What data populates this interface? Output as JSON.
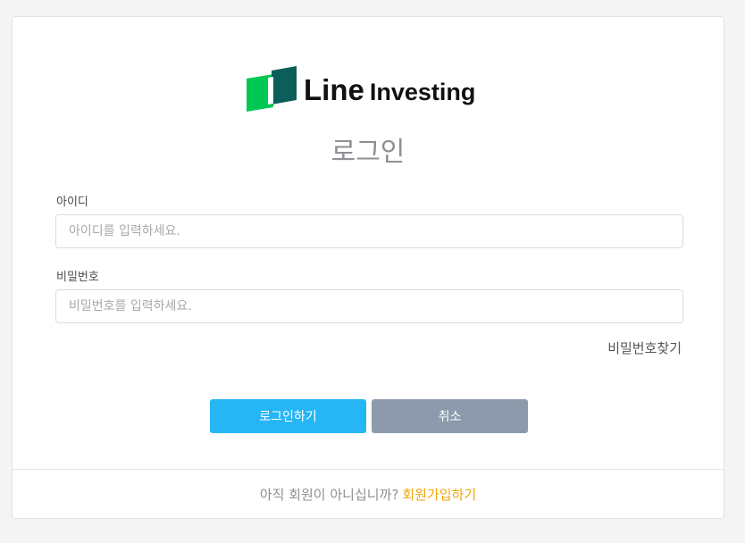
{
  "logo": {
    "text_main": "Line",
    "text_sub": "Investing",
    "mark_colors": [
      "#00c853",
      "#0b5e59"
    ]
  },
  "title": "로그인",
  "form": {
    "id_label": "아이디",
    "id_placeholder": "아이디를 입력하세요.",
    "id_value": "",
    "pw_label": "비밀번호",
    "pw_placeholder": "비밀번호를 입력하세요.",
    "pw_value": "",
    "find_password": "비밀번호찾기"
  },
  "buttons": {
    "login": "로그인하기",
    "cancel": "취소"
  },
  "footer": {
    "question": "아직 회원이 아니십니까?",
    "signup": "회원가입하기"
  },
  "colors": {
    "login_button": "#26b6f5",
    "cancel_button": "#8c9aab",
    "signup_link": "#f0a60b"
  }
}
